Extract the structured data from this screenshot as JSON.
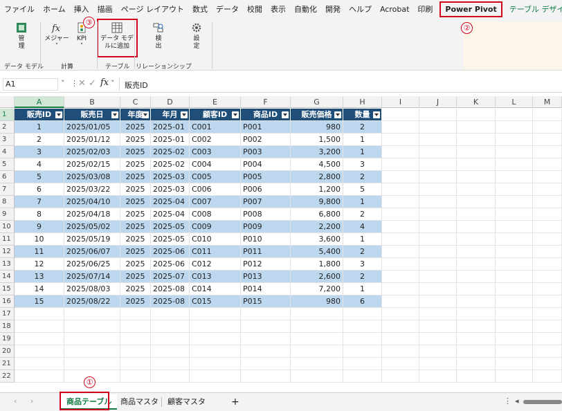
{
  "menu_tabs": [
    "ファイル",
    "ホーム",
    "挿入",
    "描画",
    "ページ レイアウト",
    "数式",
    "データ",
    "校閲",
    "表示",
    "自動化",
    "開発",
    "ヘルプ",
    "Acrobat",
    "印刷",
    "Power Pivot",
    "テーブル デザイン"
  ],
  "ribbon": {
    "manage": "管\n理",
    "measures": "メジャー",
    "kpi": "KPI",
    "add_to_model": "データ モデ\nルに追加",
    "detect": "検\n出",
    "settings": "設\n定",
    "groups": [
      "データ モデル",
      "計算",
      "テーブル",
      "リレーションシップ"
    ]
  },
  "callouts": [
    "①",
    "②",
    "③"
  ],
  "formula_bar": {
    "name_box": "A1",
    "fx": "fx",
    "value": "販売ID"
  },
  "columns": [
    "A",
    "B",
    "C",
    "D",
    "E",
    "F",
    "G",
    "H",
    "I",
    "J",
    "K",
    "L",
    "M"
  ],
  "row_numbers": [
    "1",
    "2",
    "3",
    "4",
    "5",
    "6",
    "7",
    "8",
    "9",
    "10",
    "11",
    "12",
    "13",
    "14",
    "15",
    "16",
    "17",
    "18",
    "19",
    "20",
    "21",
    "22"
  ],
  "table_headers": [
    "販売ID",
    "販売日",
    "年度",
    "年月",
    "顧客ID",
    "商品ID",
    "販売価格",
    "数量"
  ],
  "table_rows": [
    [
      "1",
      "2025/01/05",
      "2025",
      "2025-01",
      "C001",
      "P001",
      "980",
      "2"
    ],
    [
      "2",
      "2025/01/12",
      "2025",
      "2025-01",
      "C002",
      "P002",
      "1,500",
      "1"
    ],
    [
      "3",
      "2025/02/03",
      "2025",
      "2025-02",
      "C003",
      "P003",
      "3,200",
      "1"
    ],
    [
      "4",
      "2025/02/15",
      "2025",
      "2025-02",
      "C004",
      "P004",
      "4,500",
      "3"
    ],
    [
      "5",
      "2025/03/08",
      "2025",
      "2025-03",
      "C005",
      "P005",
      "2,800",
      "2"
    ],
    [
      "6",
      "2025/03/22",
      "2025",
      "2025-03",
      "C006",
      "P006",
      "1,200",
      "5"
    ],
    [
      "7",
      "2025/04/10",
      "2025",
      "2025-04",
      "C007",
      "P007",
      "9,800",
      "1"
    ],
    [
      "8",
      "2025/04/18",
      "2025",
      "2025-04",
      "C008",
      "P008",
      "6,800",
      "2"
    ],
    [
      "9",
      "2025/05/02",
      "2025",
      "2025-05",
      "C009",
      "P009",
      "2,200",
      "4"
    ],
    [
      "10",
      "2025/05/19",
      "2025",
      "2025-05",
      "C010",
      "P010",
      "3,600",
      "1"
    ],
    [
      "11",
      "2025/06/07",
      "2025",
      "2025-06",
      "C011",
      "P011",
      "5,400",
      "2"
    ],
    [
      "12",
      "2025/06/25",
      "2025",
      "2025-06",
      "C012",
      "P012",
      "1,800",
      "3"
    ],
    [
      "13",
      "2025/07/14",
      "2025",
      "2025-07",
      "C013",
      "P013",
      "2,600",
      "2"
    ],
    [
      "14",
      "2025/08/03",
      "2025",
      "2025-08",
      "C014",
      "P014",
      "7,200",
      "1"
    ],
    [
      "15",
      "2025/08/22",
      "2025",
      "2025-08",
      "C015",
      "P015",
      "980",
      "6"
    ]
  ],
  "sheet_tabs": [
    "商品テーブル",
    "商品マスタ",
    "顧客マスタ"
  ],
  "add_sheet": "+",
  "colors": {
    "header_bg": "#1f4e79",
    "band_bg": "#bdd7ee",
    "accent": "#107c41",
    "highlight": "#d0021b"
  }
}
